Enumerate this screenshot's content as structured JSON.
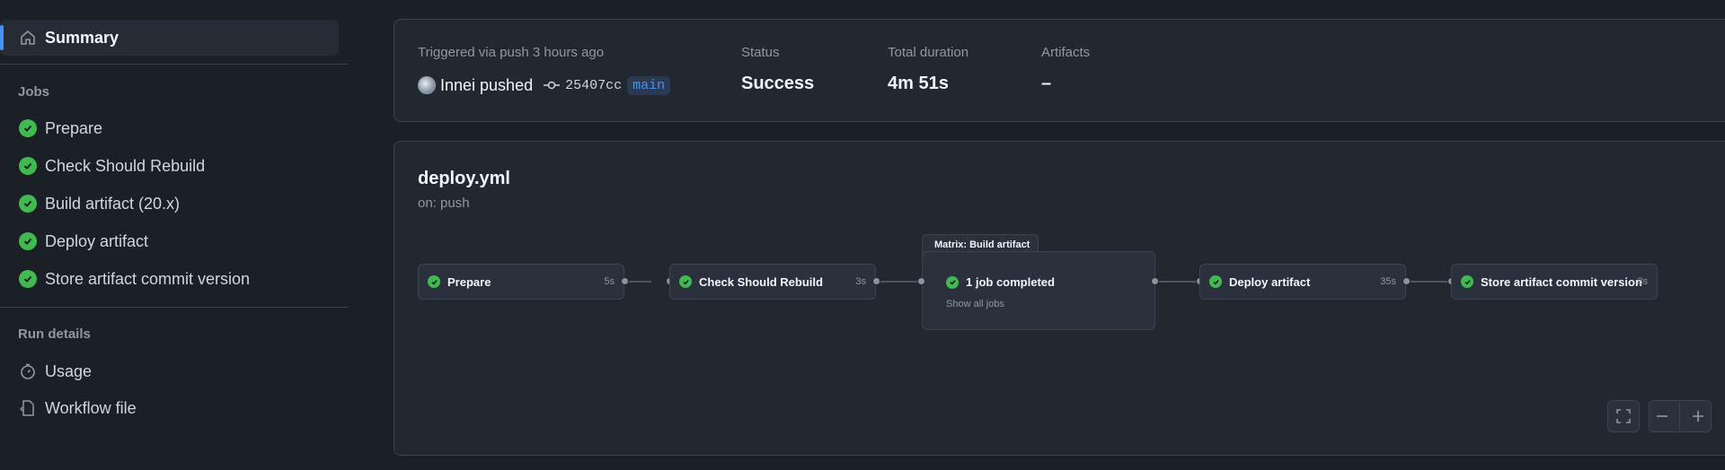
{
  "sidebar": {
    "summary_label": "Summary",
    "jobs_heading": "Jobs",
    "jobs": [
      {
        "label": "Prepare",
        "status": "success"
      },
      {
        "label": "Check Should Rebuild",
        "status": "success"
      },
      {
        "label": "Build artifact (20.x)",
        "status": "success"
      },
      {
        "label": "Deploy artifact",
        "status": "success"
      },
      {
        "label": "Store artifact commit version",
        "status": "success"
      }
    ],
    "run_details_heading": "Run details",
    "run_details": [
      {
        "label": "Usage",
        "icon": "stopwatch-icon"
      },
      {
        "label": "Workflow file",
        "icon": "file-code-icon"
      }
    ]
  },
  "run_summary": {
    "trigger_text": "Triggered via push 3 hours ago",
    "pusher": "Innei pushed",
    "commit": "25407cc",
    "branch": "main",
    "status_label": "Status",
    "status_value": "Success",
    "duration_label": "Total duration",
    "duration_value": "4m 51s",
    "artifacts_label": "Artifacts",
    "artifacts_value": "–"
  },
  "workflow": {
    "title": "deploy.yml",
    "trigger": "on: push",
    "nodes": [
      {
        "label": "Prepare",
        "duration": "5s"
      },
      {
        "label": "Check Should Rebuild",
        "duration": "3s"
      },
      {
        "label": "Deploy artifact",
        "duration": "35s"
      },
      {
        "label": "Store artifact commit version",
        "duration": "3s"
      }
    ],
    "matrix": {
      "title": "Matrix: Build artifact",
      "job_label": "1 job completed",
      "show_all": "Show all jobs"
    }
  },
  "colors": {
    "success": "#3fb950",
    "accent": "#4493f8",
    "background": "#1b1f26"
  }
}
